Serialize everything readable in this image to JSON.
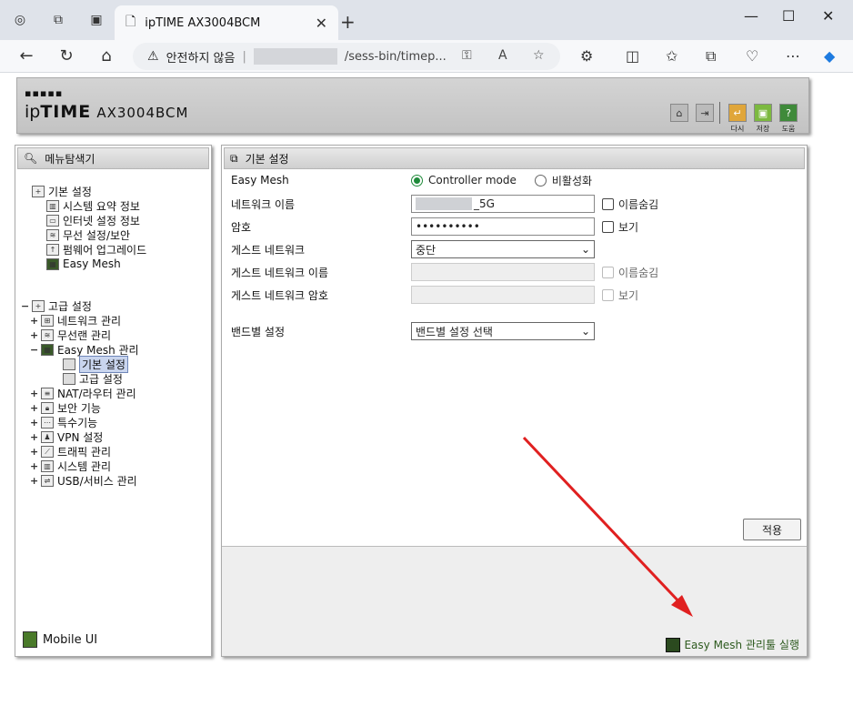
{
  "browser": {
    "tab_title": "ipTIME AX3004BCM",
    "address": {
      "security_label": "안전하지 않음",
      "path": "/sess-bin/timep..."
    }
  },
  "router": {
    "logo_dots": "▪▪▪▪▪",
    "brand_ip": "ip",
    "brand_time": "TIME",
    "model": "AX3004BCM",
    "header_buttons": [
      {
        "label": "다시"
      },
      {
        "label": "저장"
      },
      {
        "label": "도움"
      }
    ]
  },
  "menu": {
    "title": "메뉴탐색기",
    "basic": {
      "label": "기본 설정",
      "items": [
        "시스템 요약 정보",
        "인터넷 설정 정보",
        "무선 설정/보안",
        "펌웨어 업그레이드",
        "Easy Mesh"
      ]
    },
    "advanced": {
      "label": "고급 설정",
      "items": [
        {
          "label": "네트워크 관리",
          "exp": "+"
        },
        {
          "label": "무선랜 관리",
          "exp": "+"
        },
        {
          "label": "Easy Mesh 관리",
          "exp": "−"
        },
        {
          "label": "NAT/라우터 관리",
          "exp": "+"
        },
        {
          "label": "보안 기능",
          "exp": "+"
        },
        {
          "label": "특수기능",
          "exp": "+"
        },
        {
          "label": "VPN 설정",
          "exp": "+"
        },
        {
          "label": "트래픽 관리",
          "exp": "+"
        },
        {
          "label": "시스템 관리",
          "exp": "+"
        },
        {
          "label": "USB/서비스 관리",
          "exp": "+"
        }
      ],
      "mesh_children": [
        "기본 설정",
        "고급 설정"
      ]
    },
    "mobile_ui": "Mobile UI"
  },
  "main": {
    "title": "기본 설정",
    "easy_mesh": {
      "label": "Easy Mesh",
      "option1": "Controller mode",
      "option2": "비활성화"
    },
    "network_name": {
      "label": "네트워크 이름",
      "value": "_5G",
      "check": "이름숨김"
    },
    "password": {
      "label": "암호",
      "value": "••••••••••",
      "check": "보기"
    },
    "guest": {
      "label": "게스트 네트워크",
      "value": "중단"
    },
    "guest_name": {
      "label": "게스트 네트워크 이름",
      "check": "이름숨김"
    },
    "guest_pw": {
      "label": "게스트 네트워크 암호",
      "check": "보기"
    },
    "band": {
      "label": "밴드별 설정",
      "value": "밴드별 설정 선택"
    },
    "apply": "적용",
    "mesh_link": "Easy Mesh 관리툴 실행"
  },
  "colors": {
    "arrow": "#e02020",
    "accent_green": "#1f8a3a"
  }
}
